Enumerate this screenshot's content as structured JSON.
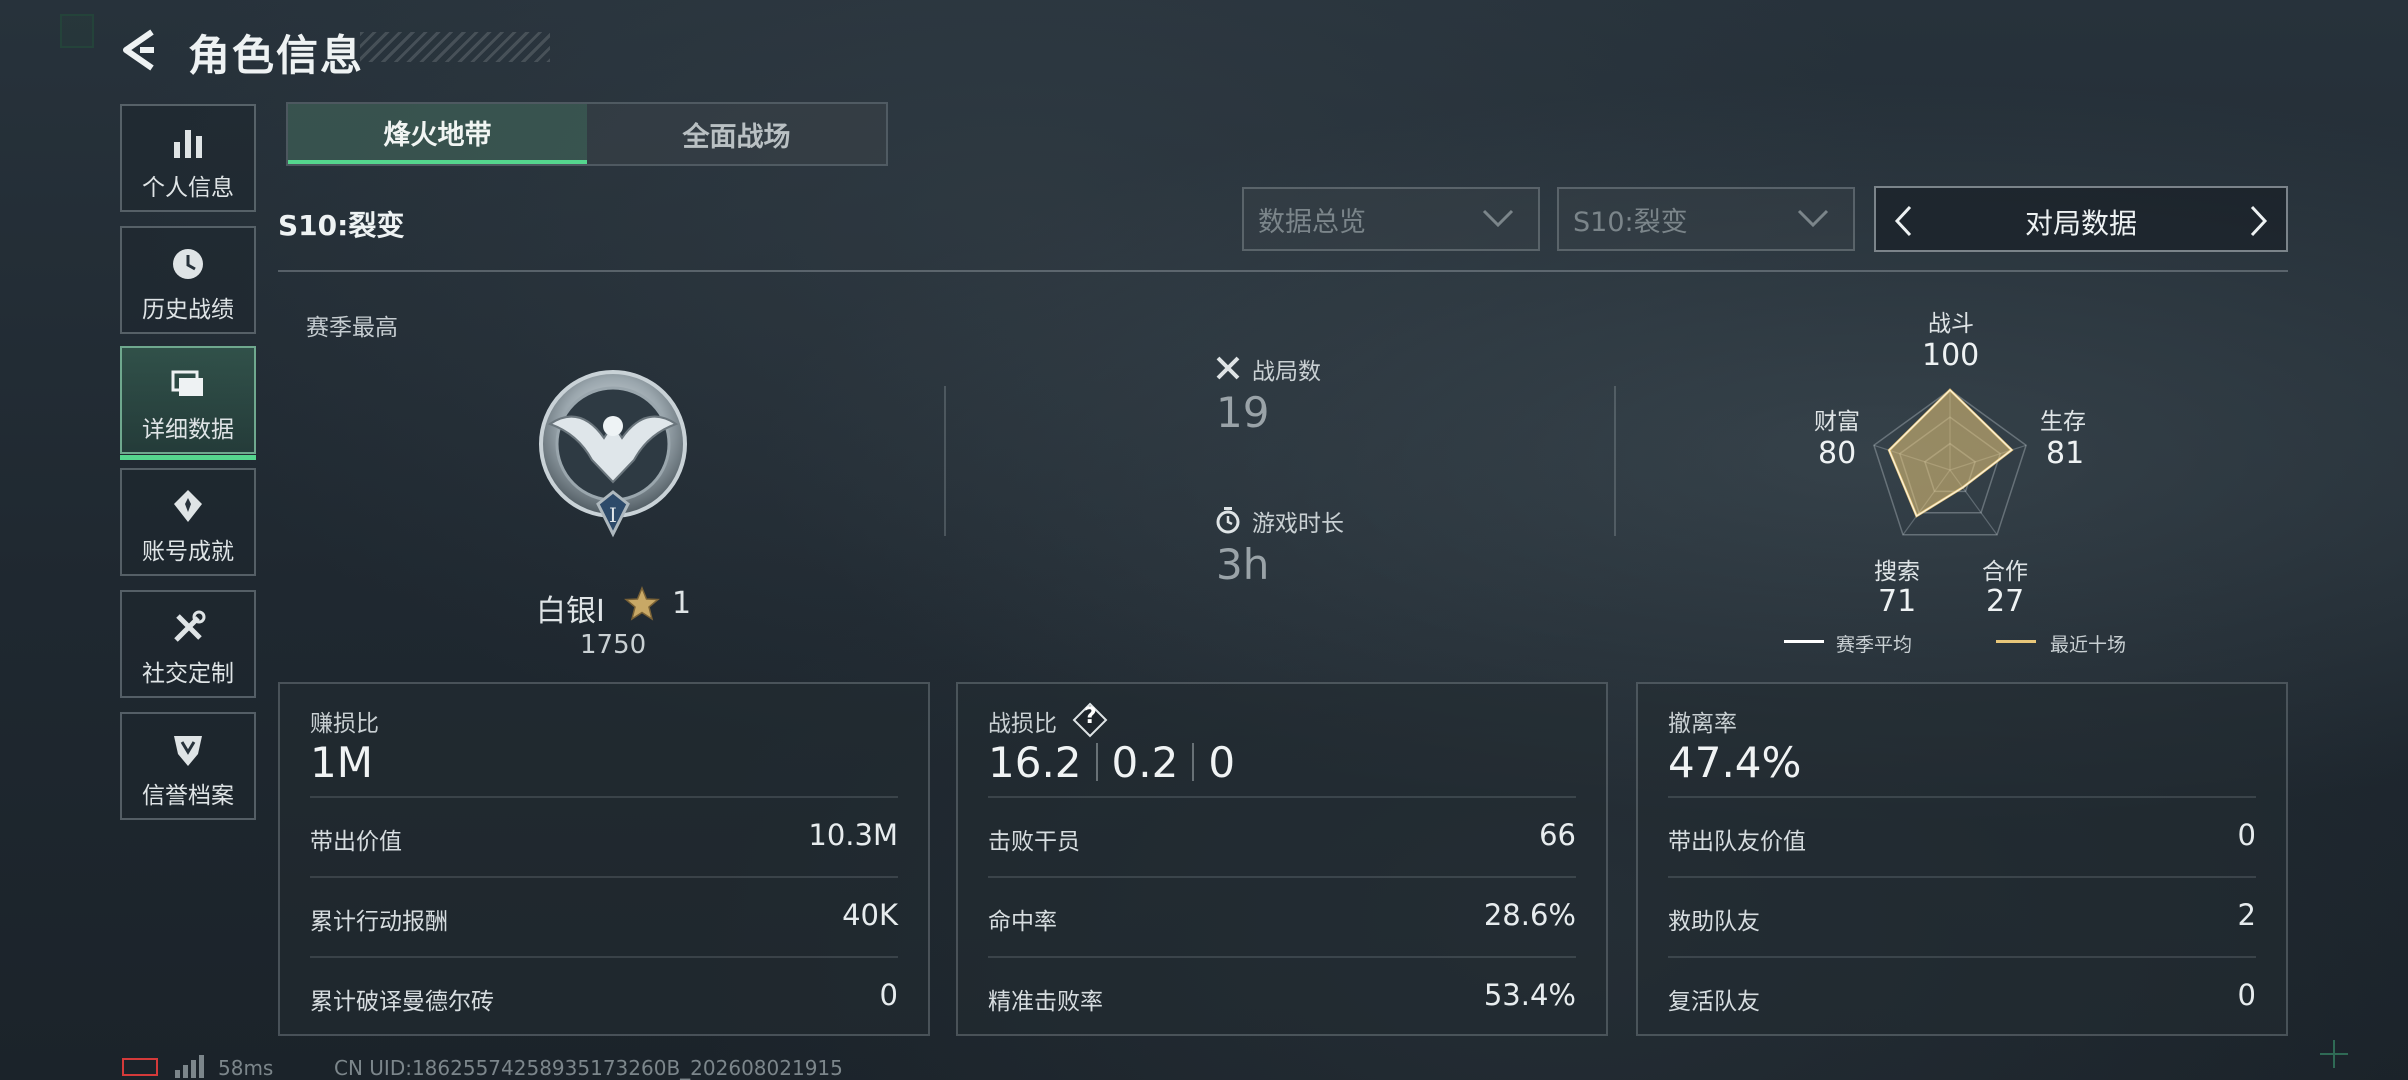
{
  "header": {
    "title": "角色信息"
  },
  "sidebar": {
    "items": [
      {
        "label": "个人信息",
        "icon": "bar-chart-icon",
        "active": false
      },
      {
        "label": "历史战绩",
        "icon": "clock-icon",
        "active": false
      },
      {
        "label": "详细数据",
        "icon": "folders-icon",
        "active": true
      },
      {
        "label": "账号成就",
        "icon": "achievement-icon",
        "active": false
      },
      {
        "label": "社交定制",
        "icon": "tools-icon",
        "active": false
      },
      {
        "label": "信誉档案",
        "icon": "shield-icon",
        "active": false
      }
    ]
  },
  "tabs": [
    {
      "label": "烽火地带",
      "active": true
    },
    {
      "label": "全面战场",
      "active": false
    }
  ],
  "season_label": "S10:裂变",
  "filters": {
    "overview": "数据总览",
    "season": "S10:裂变",
    "mode": "对局数据"
  },
  "summary": {
    "season_high_label": "赛季最高",
    "rank_name": "白银I",
    "rank_stars": "1",
    "rank_score": "1750",
    "matches_label": "战局数",
    "matches_value": "19",
    "playtime_label": "游戏时长",
    "playtime_value": "3h"
  },
  "radar": {
    "axes": [
      {
        "label": "战斗",
        "value": "100"
      },
      {
        "label": "生存",
        "value": "81"
      },
      {
        "label": "合作",
        "value": "27"
      },
      {
        "label": "搜索",
        "value": "71"
      },
      {
        "label": "财富",
        "value": "80"
      }
    ],
    "legend": {
      "season_avg": "赛季平均",
      "recent_ten": "最近十场"
    },
    "colors": {
      "season_avg": "#ffffff",
      "recent_ten": "#e8c77a"
    }
  },
  "cards": {
    "profit": {
      "title": "赚损比",
      "value": "1M",
      "rows": [
        {
          "label": "带出价值",
          "value": "10.3M"
        },
        {
          "label": "累计行动报酬",
          "value": "40K"
        },
        {
          "label": "累计破译曼德尔砖",
          "value": "0"
        }
      ]
    },
    "kd": {
      "title": "战损比",
      "help": "?",
      "values": [
        "16.2",
        "0.2",
        "0"
      ],
      "rows": [
        {
          "label": "击败干员",
          "value": "66"
        },
        {
          "label": "命中率",
          "value": "28.6%"
        },
        {
          "label": "精准击败率",
          "value": "53.4%"
        }
      ]
    },
    "extract": {
      "title": "撤离率",
      "value": "47.4%",
      "rows": [
        {
          "label": "带出队友价值",
          "value": "0"
        },
        {
          "label": "救助队友",
          "value": "2"
        },
        {
          "label": "复活队友",
          "value": "0"
        }
      ]
    }
  },
  "footer": {
    "ping": "58ms",
    "uid": "CN UID:18625574258935173260B_202608021915"
  },
  "colors": {
    "accent": "#55d68e",
    "battery_low": "#d43a3a"
  }
}
